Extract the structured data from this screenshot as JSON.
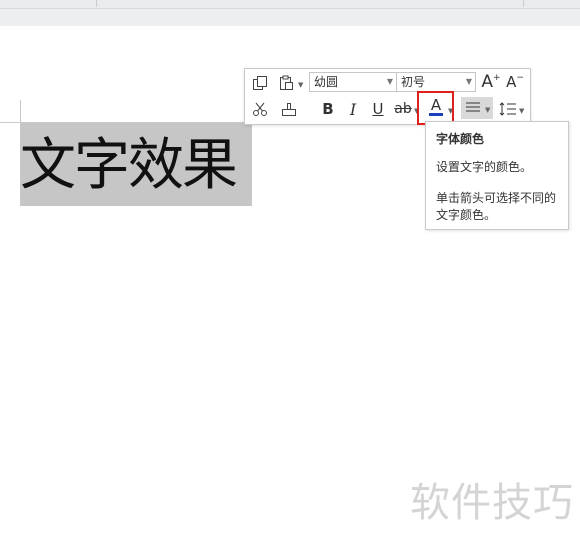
{
  "document": {
    "text": "文字效果"
  },
  "toolbar": {
    "font_name": "幼圆",
    "font_size": "初号",
    "increase_font_label": "A",
    "decrease_font_label": "A",
    "bold_label": "B",
    "italic_label": "I",
    "underline_label": "U",
    "strikethrough_label": "ab",
    "font_color_label": "A",
    "font_color_underline": "#1a3fbf",
    "highlight_color": "#e0201e"
  },
  "tooltip": {
    "title": "字体颜色",
    "line1": "设置文字的颜色。",
    "line2": "单击箭头可选择不同的",
    "line3": "文字颜色。"
  },
  "watermark": {
    "text": "软件技巧"
  },
  "icons": [
    "copy-icon",
    "paste-icon",
    "cut-icon",
    "format-painter-icon",
    "align-icon",
    "line-spacing-icon"
  ]
}
